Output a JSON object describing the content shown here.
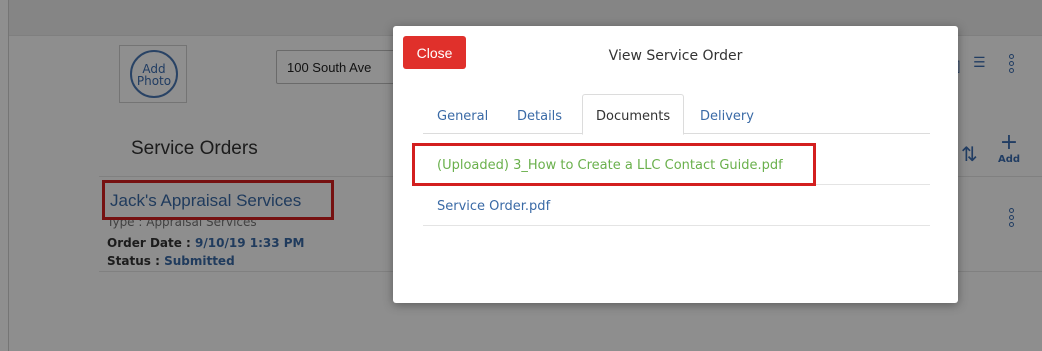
{
  "background": {
    "add_photo": [
      "Add",
      "Photo"
    ],
    "address_value": "100 South Ave",
    "section_title": "Service Orders",
    "add_label": "Add",
    "card": {
      "name": "Jack's Appraisal Services",
      "type_line": "Type : Appraisal Services",
      "order_date_label": "Order Date : ",
      "order_date_value": "9/10/19 1:33 PM",
      "status_label": "Status : ",
      "status_value": "Submitted"
    }
  },
  "modal": {
    "close_label": "Close",
    "title": "View Service Order",
    "tabs": [
      {
        "label": "General",
        "active": false
      },
      {
        "label": "Details",
        "active": false
      },
      {
        "label": "Documents",
        "active": true
      },
      {
        "label": "Delivery",
        "active": false
      }
    ],
    "documents": [
      {
        "name": "(Uploaded) 3_How to Create a LLC Contact Guide.pdf",
        "status": "uploaded"
      },
      {
        "name": "Service Order.pdf",
        "status": "generated"
      }
    ]
  },
  "colors": {
    "accent": "#3a6aa6",
    "close_red": "#e0302b",
    "uploaded_green": "#6ab04c",
    "highlight_red": "#d31f1f"
  },
  "icons": [
    "plus-icon",
    "sort-icon",
    "contact-card-icon",
    "map-icon",
    "kebab-menu-icon"
  ]
}
